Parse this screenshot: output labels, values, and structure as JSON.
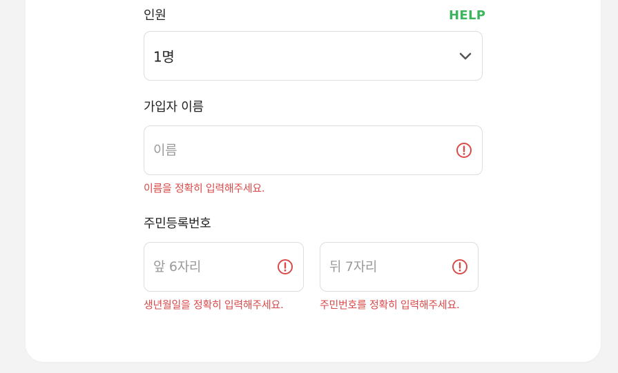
{
  "people": {
    "label": "인원",
    "help": "HELP",
    "selected": "1명"
  },
  "name": {
    "label": "가입자 이름",
    "placeholder": "이름",
    "error": "이름을 정확히 입력해주세요."
  },
  "rrn": {
    "label": "주민등록번호",
    "front_placeholder": "앞 6자리",
    "back_placeholder": "뒤 7자리",
    "front_error": "생년월일을 정확히 입력해주세요.",
    "back_error": "주민번호를 정확히 입력해주세요."
  },
  "colors": {
    "help": "#3cb55f",
    "error": "#d84a4a",
    "border": "#dddddd"
  },
  "icons": {
    "dropdown": "chevron-down-icon",
    "error": "alert-circle-icon"
  }
}
